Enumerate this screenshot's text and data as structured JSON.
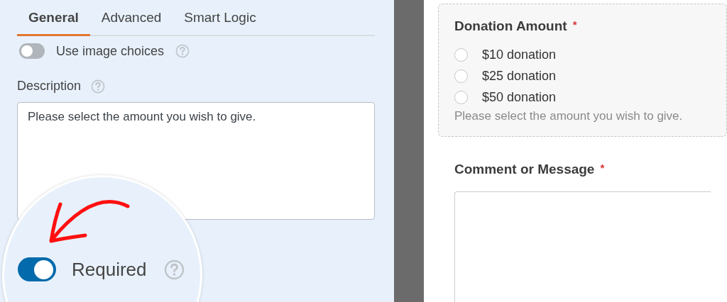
{
  "settings": {
    "tabs": [
      {
        "label": "General",
        "selected": true
      },
      {
        "label": "Advanced",
        "selected": false
      },
      {
        "label": "Smart Logic",
        "selected": false
      }
    ],
    "image_choices": {
      "label": "Use image choices",
      "on": false
    },
    "description": {
      "label": "Description",
      "value": "Please select the amount you wish to give."
    }
  },
  "magnifier": {
    "required": {
      "label": "Required",
      "on": true
    }
  },
  "preview": {
    "fields": [
      {
        "kind": "radio",
        "label": "Donation Amount",
        "required_mark": "*",
        "selected": true,
        "options": [
          {
            "label": "$10 donation",
            "selected": false
          },
          {
            "label": "$25 donation",
            "selected": false
          },
          {
            "label": "$50 donation",
            "selected": false
          }
        ],
        "description": "Please select the amount you wish to give."
      },
      {
        "kind": "textarea",
        "label": "Comment or Message",
        "required_mark": "*",
        "selected": false
      }
    ]
  }
}
